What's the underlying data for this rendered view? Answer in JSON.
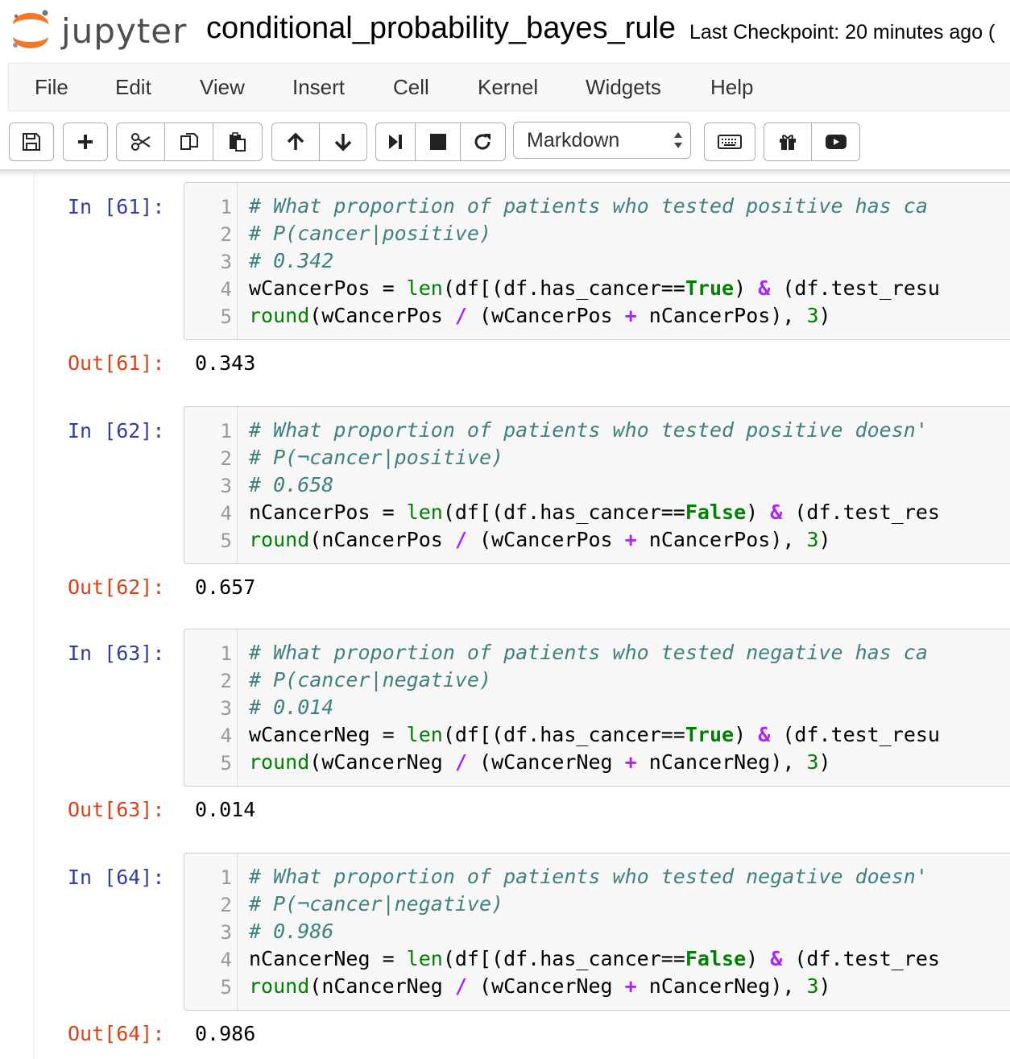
{
  "header": {
    "logo_text": "jupyter",
    "notebook_name": "conditional_probability_bayes_rule",
    "checkpoint": "Last Checkpoint: 20 minutes ago ("
  },
  "menu": [
    "File",
    "Edit",
    "View",
    "Insert",
    "Cell",
    "Kernel",
    "Widgets",
    "Help"
  ],
  "toolbar": {
    "cell_type": "Markdown",
    "icons": [
      "save-icon",
      "plus-icon",
      "cut-icon",
      "copy-icon",
      "paste-icon",
      "arrow-up-icon",
      "arrow-down-icon",
      "step-forward-icon",
      "stop-icon",
      "refresh-icon",
      "keyboard-icon",
      "gift-icon",
      "youtube-icon"
    ]
  },
  "colors": {
    "prompt_in": "#303f9f",
    "prompt_out": "#d84315",
    "comment": "#408080",
    "builtin": "#008000",
    "operator": "#aa22ff"
  },
  "cells": [
    {
      "in_prompt": "In [61]:",
      "out_prompt": "Out[61]:",
      "output": "0.343",
      "line_numbers": [
        "1",
        "2",
        "3",
        "4",
        "5"
      ],
      "comment1": "# What proportion of patients who tested positive has ca",
      "comment2": "# P(cancer|positive)",
      "comment3": "# 0.342",
      "var": "wCancerPos",
      "bool": "True",
      "line4_tail": "(df.test_resu",
      "num_var": "wCancerPos",
      "a": "wCancerPos",
      "b": "nCancerPos"
    },
    {
      "in_prompt": "In [62]:",
      "out_prompt": "Out[62]:",
      "output": "0.657",
      "line_numbers": [
        "1",
        "2",
        "3",
        "4",
        "5"
      ],
      "comment1": "# What proportion of patients who tested positive doesn'",
      "comment2": "# P(¬cancer|positive)",
      "comment3": "# 0.658",
      "var": "nCancerPos",
      "bool": "False",
      "line4_tail": "(df.test_res",
      "num_var": "nCancerPos",
      "a": "wCancerPos",
      "b": "nCancerPos"
    },
    {
      "in_prompt": "In [63]:",
      "out_prompt": "Out[63]:",
      "output": "0.014",
      "line_numbers": [
        "1",
        "2",
        "3",
        "4",
        "5"
      ],
      "comment1": "# What proportion of patients who tested negative has ca",
      "comment2": "# P(cancer|negative)",
      "comment3": "# 0.014",
      "var": "wCancerNeg",
      "bool": "True",
      "line4_tail": "(df.test_resu",
      "num_var": "wCancerNeg",
      "a": "wCancerNeg",
      "b": "nCancerNeg"
    },
    {
      "in_prompt": "In [64]:",
      "out_prompt": "Out[64]:",
      "output": "0.986",
      "line_numbers": [
        "1",
        "2",
        "3",
        "4",
        "5"
      ],
      "comment1": "# What proportion of patients who tested negative doesn'",
      "comment2": "# P(¬cancer|negative)",
      "comment3": "# 0.986",
      "var": "nCancerNeg",
      "bool": "False",
      "line4_tail": "(df.test_res",
      "num_var": "nCancerNeg",
      "a": "wCancerNeg",
      "b": "nCancerNeg"
    }
  ],
  "code_tokens": {
    "assign": " = ",
    "len": "len",
    "df_open": "(df[(df.has_cancer==",
    "amp": "&",
    "round": "round",
    "paren_open": "(",
    "slash": "/",
    "paren2": "(",
    "plus": "+",
    "close_comma": "), ",
    "three": "3",
    "close": ")"
  }
}
